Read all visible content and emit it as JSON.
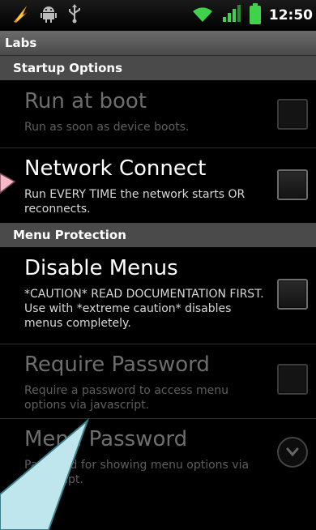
{
  "status_bar": {
    "time": "12:50",
    "left_icons": [
      "flame-icon",
      "android-icon",
      "usb-icon"
    ],
    "right_icons": [
      "wifi-icon",
      "signal-icon",
      "battery-icon"
    ]
  },
  "title": "Labs",
  "categories": {
    "startup": "Startup Options",
    "menu": "Menu Protection"
  },
  "prefs": {
    "run_at_boot": {
      "title": "Run at boot",
      "summary": "Run as soon as device boots.",
      "enabled": false,
      "checked": false
    },
    "network_connect": {
      "title": "Network Connect",
      "summary": "Run EVERY TIME the network starts OR reconnects.",
      "enabled": true,
      "checked": false
    },
    "disable_menus": {
      "title": "Disable Menus",
      "summary": "*CAUTION* READ DOCUMENTATION FIRST. Use with *extreme caution* disables menus completely.",
      "enabled": true,
      "checked": false
    },
    "require_password": {
      "title": "Require Password",
      "summary": "Require a password to access menu options via javascript.",
      "enabled": false,
      "checked": false
    },
    "menu_password": {
      "title": "Menu Password",
      "summary": "Password for showing menu options via javascript.",
      "enabled": false
    }
  },
  "colors": {
    "callout_fill": "#bfe6ec",
    "callout_stroke": "#4a8f9a",
    "pink_callout": "#f4b8c8"
  }
}
